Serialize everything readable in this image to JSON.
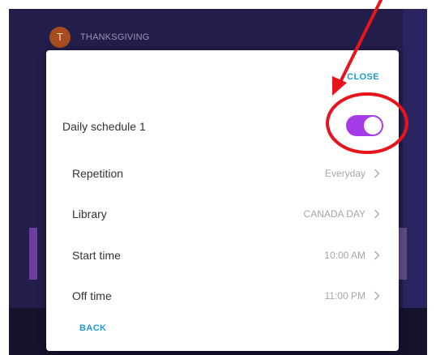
{
  "background": {
    "avatar_letter": "T",
    "playlist_title": "THANKSGIVING"
  },
  "dialog": {
    "close_label": "CLOSE",
    "schedule_title": "Daily schedule 1",
    "toggle_on": true,
    "rows": [
      {
        "label": "Repetition",
        "value": "Everyday"
      },
      {
        "label": "Library",
        "value": "CANADA DAY"
      },
      {
        "label": "Start time",
        "value": "10:00 AM"
      },
      {
        "label": "Off time",
        "value": "11:00 PM"
      }
    ],
    "back_label": "BACK"
  },
  "colors": {
    "accent_blue": "#1e9bd7",
    "toggle_purple": "#a63ce8",
    "annotation_red": "#e8141b",
    "app_background": "#221d4a"
  }
}
